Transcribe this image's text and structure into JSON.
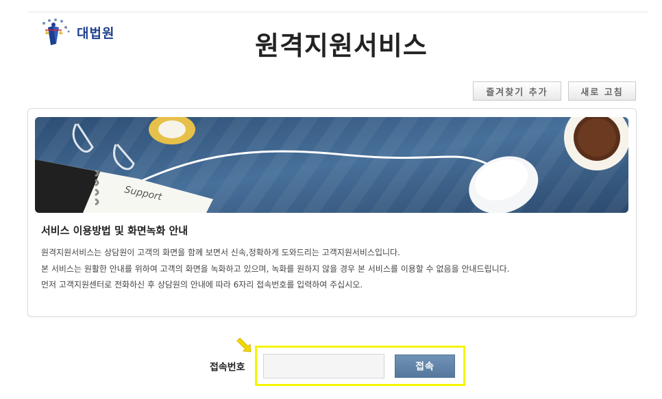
{
  "header": {
    "logo_text": "대법원",
    "title": "원격지원서비스"
  },
  "toolbar": {
    "bookmark_label": "즐겨찾기 추가",
    "refresh_label": "새로 고침"
  },
  "banner": {
    "notepad_text": "Support"
  },
  "notice": {
    "heading": "서비스 이용방법 및 화면녹화 안내",
    "lines": [
      "원격지원서비스는 상담원이 고객의 화면을 함께 보면서 신속,정확하게 도와드리는 고객지원서비스입니다.",
      "본 서비스는 원활한 안내를 위하여 고객의 화면을 녹화하고 있으며, 녹화를 원하지 않을 경우 본 서비스를 이용할 수 없음을 안내드립니다.",
      "먼저 고객지원센터로 전화하신 후 상담원의 안내에 따라 6자리 접속번호를 입력하여 주십시오."
    ]
  },
  "login": {
    "label": "접속번호",
    "input_value": "",
    "input_placeholder": "",
    "connect_label": "접속"
  },
  "colors": {
    "highlight": "#f5f500",
    "button_blue": "#6283a8",
    "logo_blue": "#1d3f8f",
    "banner_bg": "#3a5f86"
  },
  "icons": {
    "logo": "court-emblem-icon",
    "pointer": "yellow-arrow-icon"
  }
}
